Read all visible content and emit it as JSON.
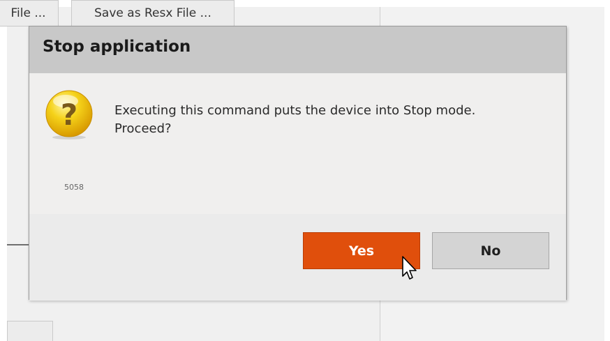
{
  "background": {
    "toolbar": {
      "file_button_label": "File ...",
      "save_resx_button_label": "Save as Resx File ..."
    }
  },
  "dialog": {
    "title": "Stop application",
    "icon": "question-icon",
    "message_lines": [
      "Executing this command puts the device into Stop mode.",
      "Proceed?"
    ],
    "code": "5058",
    "buttons": {
      "yes_label": "Yes",
      "no_label": "No"
    }
  },
  "colors": {
    "yes_button": "#e04f0c",
    "header": "#c8c8c8",
    "icon_yellow": "#f5c400"
  }
}
